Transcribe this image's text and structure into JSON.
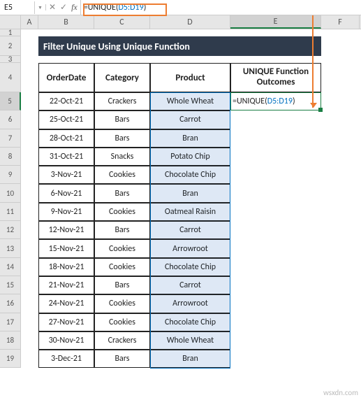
{
  "app": {
    "name_box": "E5",
    "fx_label": "fx",
    "formula_prefix": "=UNIQUE(",
    "formula_range": "D5:D19",
    "formula_suffix": ")"
  },
  "columns": {
    "a": "A",
    "b": "B",
    "c": "C",
    "d": "D",
    "e": "E",
    "f": "F"
  },
  "short_rows": [
    "1",
    "3"
  ],
  "row_nums": [
    "1",
    "2",
    "3",
    "4",
    "5",
    "6",
    "7",
    "8",
    "9",
    "10",
    "11",
    "12",
    "13",
    "14",
    "15",
    "16",
    "17",
    "18",
    "19"
  ],
  "title": "Filter Unique Using Unique Function",
  "headers": {
    "b": "OrderDate",
    "c": "Category",
    "d": "Product",
    "e": "UNIQUE Function Outcomes"
  },
  "active_formula_prefix": "=UNIQUE(",
  "active_formula_range": "D5:D19",
  "active_formula_suffix": ")",
  "rows": [
    {
      "b": "22-Oct-21",
      "c": "Crackers",
      "d": "Whole Wheat"
    },
    {
      "b": "25-Oct-21",
      "c": "Bars",
      "d": "Carrot"
    },
    {
      "b": "28-Oct-21",
      "c": "Bars",
      "d": "Bran"
    },
    {
      "b": "31-Oct-21",
      "c": "Snacks",
      "d": "Potato Chip"
    },
    {
      "b": "3-Nov-21",
      "c": "Cookies",
      "d": "Chocolate Chip"
    },
    {
      "b": "6-Nov-21",
      "c": "Bars",
      "d": "Bran"
    },
    {
      "b": "9-Nov-21",
      "c": "Cookies",
      "d": "Oatmeal Raisin"
    },
    {
      "b": "12-Nov-21",
      "c": "Bars",
      "d": "Carrot"
    },
    {
      "b": "15-Nov-21",
      "c": "Cookies",
      "d": "Arrowroot"
    },
    {
      "b": "18-Nov-21",
      "c": "Cookies",
      "d": "Chocolate Chip"
    },
    {
      "b": "21-Nov-21",
      "c": "Bars",
      "d": "Carrot"
    },
    {
      "b": "24-Nov-21",
      "c": "Cookies",
      "d": "Arrowroot"
    },
    {
      "b": "27-Nov-21",
      "c": "Cookies",
      "d": "Chocolate Chip"
    },
    {
      "b": "30-Nov-21",
      "c": "Crackers",
      "d": "Whole Wheat"
    },
    {
      "b": "3-Dec-21",
      "c": "Bars",
      "d": "Bran"
    }
  ],
  "watermark": "wsxdn.com"
}
